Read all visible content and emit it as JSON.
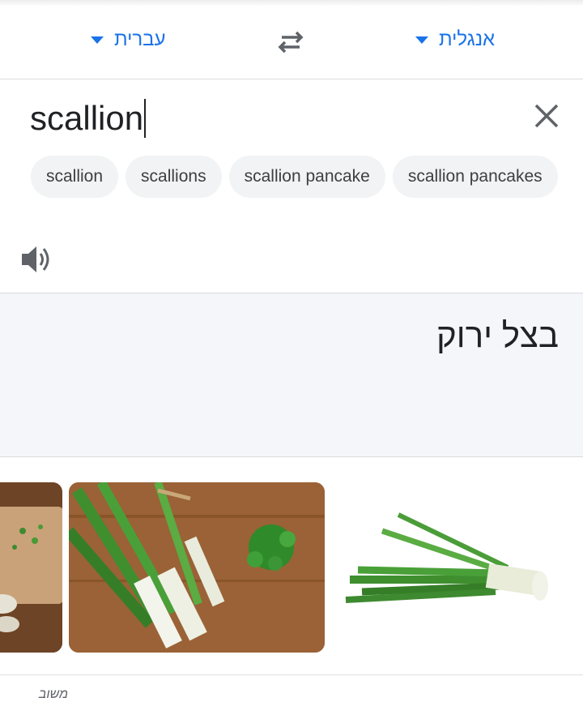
{
  "language_bar": {
    "target_language": "עברית",
    "source_language": "אנגלית",
    "swap_icon": "swap-arrows-icon"
  },
  "source": {
    "text": "scallion",
    "clear_icon": "close-icon",
    "speaker_icon": "speaker-icon",
    "suggestions": [
      "scallion",
      "scallions",
      "scallion pancake",
      "scallion pancakes"
    ]
  },
  "translation": {
    "text": "בצל ירוק"
  },
  "images": [
    {
      "alt": "scallion-image-cutting-board"
    },
    {
      "alt": "scallion-image-bundle"
    },
    {
      "alt": "scallion-image-white-background"
    }
  ],
  "footer": {
    "text": "משוב"
  },
  "colors": {
    "accent": "#1a73e8",
    "chip_bg": "#f1f3f4",
    "translation_bg": "#f4f6f9"
  }
}
